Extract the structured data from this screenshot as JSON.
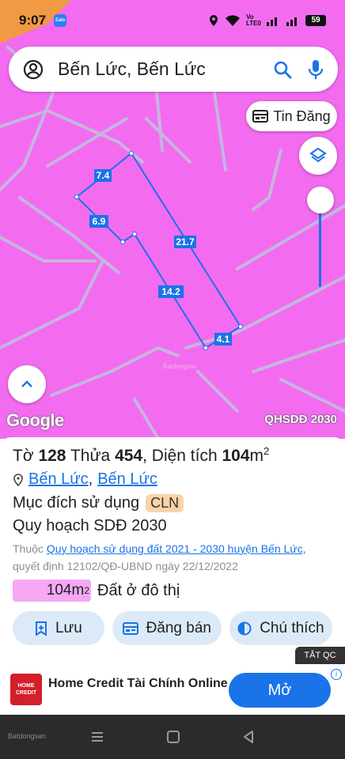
{
  "status_bar": {
    "time": "9:07",
    "zalo": "Zalo",
    "network": "Vo LTE0",
    "battery": "59"
  },
  "search": {
    "text": "Bến Lức, Bến Lức"
  },
  "map": {
    "tin_dang_label": "Tin Đăng",
    "google_label": "Google",
    "layer_label": "QHSDĐ 2030",
    "watermark": "Batdongsan",
    "dimensions": [
      "7.4",
      "6.9",
      "21.7",
      "14.2",
      "4.1"
    ],
    "colors": {
      "land": "#f36cf0",
      "road": "#c5b5df",
      "boundary": "#1a73e8",
      "label_bg": "#1a73e8"
    }
  },
  "panel": {
    "to_label": "Tờ",
    "to_value": "128",
    "thua_label": "Thửa",
    "thua_value": "454",
    "dien_tich_label": ", Diện tích",
    "dien_tich_value": "104",
    "area_unit": "m",
    "area_sup": "2",
    "location_1": "Bến Lức",
    "location_sep": ",",
    "location_2": "Bến Lức",
    "purpose_label": "Mục đích sử dụng",
    "purpose_code": "CLN",
    "plan_label": "Quy hoạch SDĐ 2030",
    "source_prefix": "Thuộc",
    "source_link": "Quy hoạch sử dụng đất 2021 - 2030 huyện Bến Lức,",
    "source_decision": "quyết định 12102/QĐ-UBND ngày 22/12/2022",
    "area_chip_value": "104m",
    "area_chip_sup": "2",
    "area_chip_label": "Đất ở đô thị",
    "buttons": {
      "save": "Lưu",
      "post": "Đăng bán",
      "legend": "Chú thích"
    }
  },
  "ad": {
    "close_label": "TẮT QC",
    "logo_line1": "HOME",
    "logo_line2": "CREDIT",
    "title": "Home Credit Tài Chính Online",
    "cta": "Mở",
    "info": "i"
  },
  "nav": {
    "brand": "Batdongsan"
  }
}
